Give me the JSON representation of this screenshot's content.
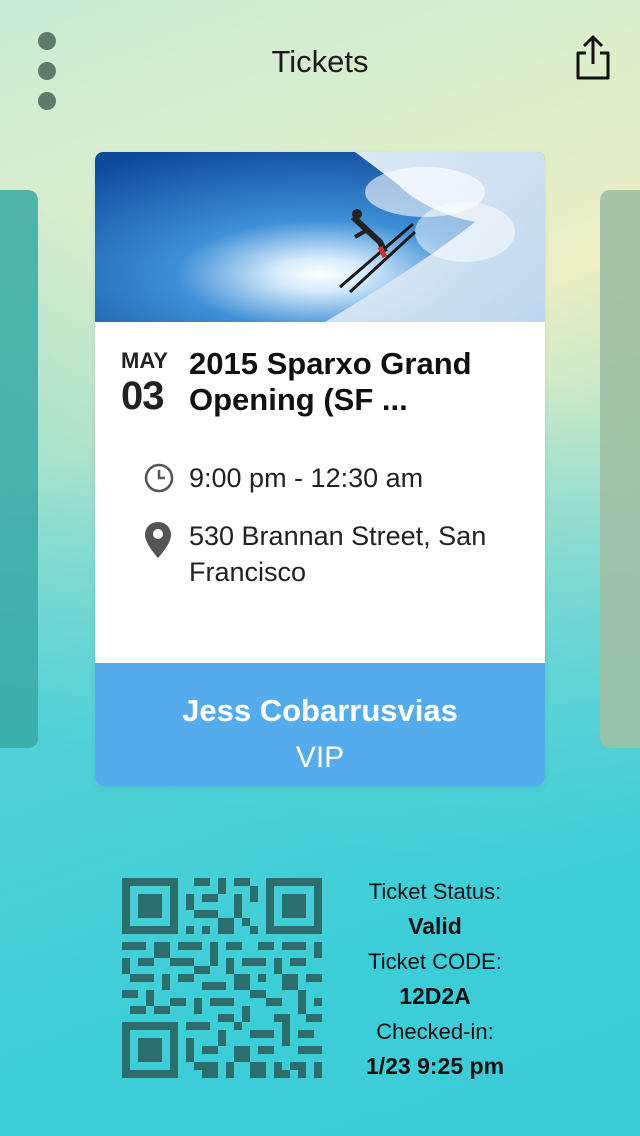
{
  "header": {
    "title": "Tickets",
    "menu_icon": "more-vertical-icon",
    "share_icon": "share-icon"
  },
  "event": {
    "month": "MAY",
    "day": "03",
    "title": "2015 Sparxo Grand Opening (SF ...",
    "time": "9:00 pm - 12:30 am",
    "location": "530 Brannan Street, San Francisco",
    "time_icon": "clock-icon",
    "location_icon": "map-pin-icon"
  },
  "holder": {
    "name": "Jess Cobarrusvias",
    "type": "VIP"
  },
  "ticket": {
    "status_label": "Ticket Status:",
    "status_value": "Valid",
    "code_label": "Ticket CODE:",
    "code_value": "12D2A",
    "checkin_label": "Checked-in:",
    "checkin_value": "1/23 9:25 pm"
  },
  "colors": {
    "accent": "#55acec",
    "qr": "#2c6e6c"
  }
}
